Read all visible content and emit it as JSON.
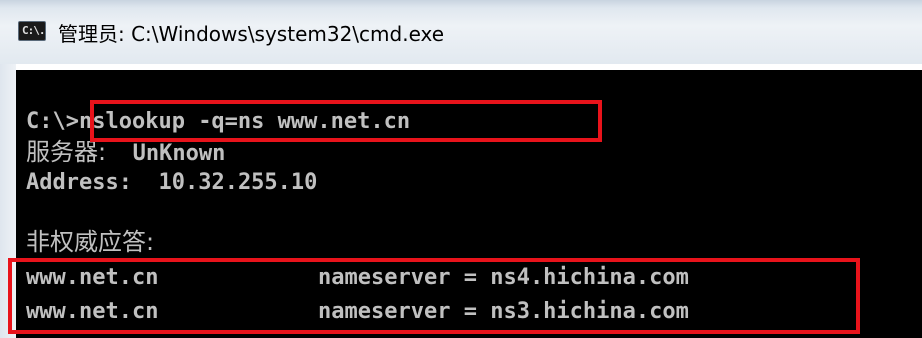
{
  "window": {
    "title": "管理员: C:\\Windows\\system32\\cmd.exe",
    "icon_name": "cmd-icon",
    "icon_glyph": "C:\\."
  },
  "console": {
    "background": "#000000",
    "text_color": "#c0c0c0",
    "prompt": "C:\\>",
    "command": "nslookup -q=ns www.net.cn",
    "server_label": "服务器:",
    "server_value": "UnKnown",
    "address_label": "Address:",
    "address_value": "10.32.255.10",
    "non_auth_header": "非权威应答:",
    "records": [
      {
        "domain": "www.net.cn",
        "type": "nameserver",
        "eq": "=",
        "value": "ns4.hichina.com"
      },
      {
        "domain": "www.net.cn",
        "type": "nameserver",
        "eq": "=",
        "value": "ns3.hichina.com"
      }
    ]
  },
  "highlight_color": "#e8131b"
}
